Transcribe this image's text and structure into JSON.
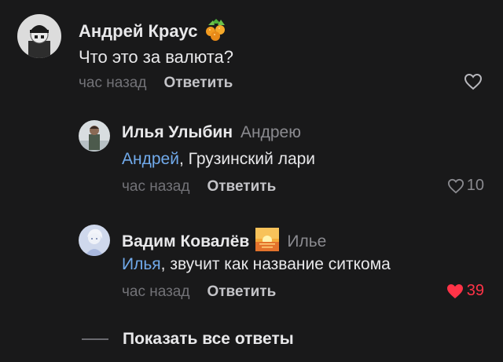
{
  "comments": [
    {
      "author": "Андрей Краус",
      "badge": "berries-icon",
      "text": "Что это за валюта?",
      "time": "час назад",
      "reply_label": "Ответить",
      "liked": false
    }
  ],
  "replies": [
    {
      "author": "Илья Улыбин",
      "reply_to": "Андрею",
      "mention": "Андрей",
      "text": ", Грузинский лари",
      "time": "час назад",
      "reply_label": "Ответить",
      "likes": "10",
      "liked": false
    },
    {
      "author": "Вадим Ковалёв",
      "badge": "sunset-icon",
      "reply_to": "Илье",
      "mention": "Илья",
      "text": ", звучит как название ситкома",
      "time": "час назад",
      "reply_label": "Ответить",
      "likes": "39",
      "liked": true
    }
  ],
  "show_all_label": "Показать все ответы",
  "colors": {
    "background": "#19191a",
    "mention": "#71aaeb",
    "like_active": "#ff3347"
  }
}
